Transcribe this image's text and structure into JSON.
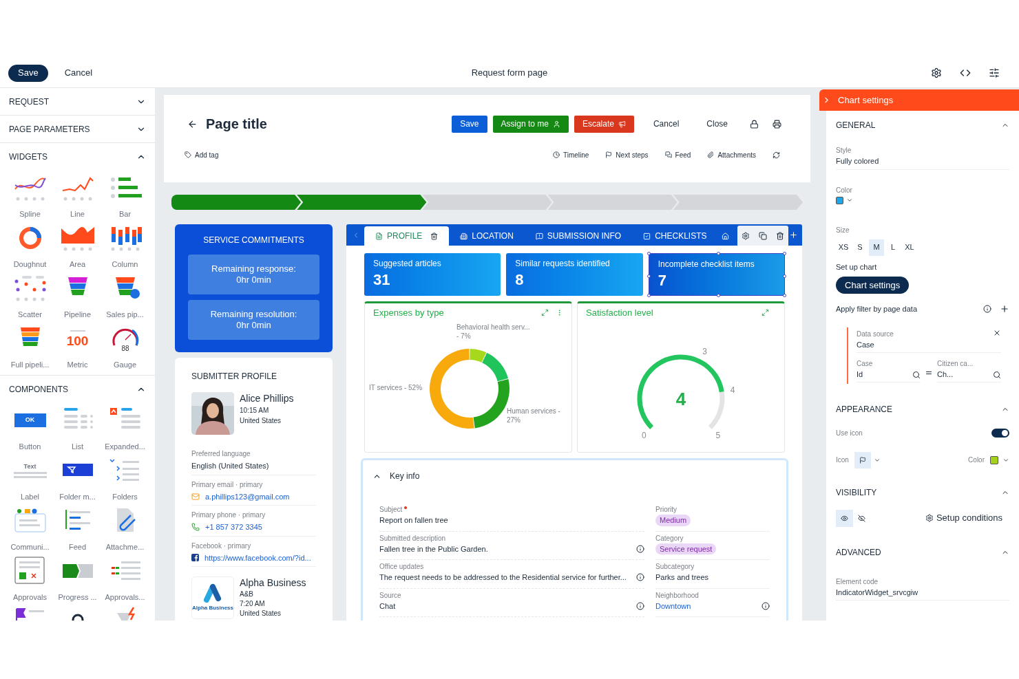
{
  "topbar": {
    "save": "Save",
    "cancel": "Cancel",
    "title": "Request form page"
  },
  "sidebar": {
    "sections": [
      {
        "title": "REQUEST",
        "expanded": false
      },
      {
        "title": "PAGE PARAMETERS",
        "expanded": false
      },
      {
        "title": "WIDGETS",
        "expanded": true,
        "items": [
          {
            "kind": "spline",
            "label": "Spline"
          },
          {
            "kind": "line",
            "label": "Line"
          },
          {
            "kind": "bar",
            "label": "Bar"
          },
          {
            "kind": "doughnut",
            "label": "Doughnut"
          },
          {
            "kind": "area",
            "label": "Area"
          },
          {
            "kind": "column",
            "label": "Column"
          },
          {
            "kind": "scatter",
            "label": "Scatter"
          },
          {
            "kind": "pipeline",
            "label": "Pipeline"
          },
          {
            "kind": "sales",
            "label": "Sales pip..."
          },
          {
            "kind": "fullpipe",
            "label": "Full pipeli..."
          },
          {
            "kind": "metric",
            "label": "Metric",
            "icon_text": "100"
          },
          {
            "kind": "gauge",
            "label": "Gauge",
            "icon_text": "88"
          }
        ]
      },
      {
        "title": "COMPONENTS",
        "expanded": true,
        "items": [
          {
            "kind": "button",
            "label": "Button",
            "icon_text": "OK"
          },
          {
            "kind": "list",
            "label": "List"
          },
          {
            "kind": "expanded",
            "label": "Expanded..."
          },
          {
            "kind": "label",
            "label": "Label",
            "icon_text": "Text"
          },
          {
            "kind": "folderm",
            "label": "Folder m..."
          },
          {
            "kind": "folders",
            "label": "Folders"
          },
          {
            "kind": "communi",
            "label": "Communi..."
          },
          {
            "kind": "feed",
            "label": "Feed"
          },
          {
            "kind": "attach",
            "label": "Attachme..."
          },
          {
            "kind": "approvals",
            "label": "Approvals"
          },
          {
            "kind": "progress",
            "label": "Progress ..."
          },
          {
            "kind": "approvals2",
            "label": "Approvals..."
          },
          {
            "kind": "flag"
          },
          {
            "kind": "circle"
          },
          {
            "kind": "bolt"
          }
        ]
      }
    ]
  },
  "page": {
    "title": "Page title",
    "buttons": [
      {
        "kind": "primary",
        "label": "Save"
      },
      {
        "kind": "assign",
        "label": "Assign to me"
      },
      {
        "kind": "escalate",
        "label": "Escalate"
      },
      {
        "kind": "plain",
        "label": "Cancel"
      },
      {
        "kind": "plain",
        "label": "Close"
      }
    ],
    "add_tag": "Add tag",
    "actions": [
      {
        "kind": "timeline",
        "label": "Timeline"
      },
      {
        "kind": "next",
        "label": "Next steps"
      },
      {
        "kind": "feed",
        "label": "Feed"
      },
      {
        "kind": "attachments",
        "label": "Attachments"
      }
    ]
  },
  "progress": [
    {
      "done": true
    },
    {
      "done": true
    },
    {
      "done": false
    },
    {
      "done": false
    },
    {
      "done": false
    }
  ],
  "service": {
    "title": "SERVICE COMMITMENTS",
    "items": [
      {
        "label": "Remaining response:",
        "value": "0hr 0min"
      },
      {
        "label": "Remaining resolution:",
        "value": "0hr 0min"
      }
    ]
  },
  "profile": {
    "title": "SUBMITTER PROFILE",
    "person": {
      "name": "Alice Phillips",
      "time": "10:15 AM",
      "country": "United States"
    },
    "fields": [
      {
        "label": "Preferred language",
        "value": "English (United States)",
        "kind": "text"
      },
      {
        "label": "Primary email · primary",
        "value": "a.phillips123@gmail.com",
        "kind": "email"
      },
      {
        "label": "Primary phone · primary",
        "value": "+1 857 372 3345",
        "kind": "phone"
      },
      {
        "label": "Facebook · primary",
        "value": "https://www.facebook.com/?id...",
        "kind": "facebook"
      }
    ],
    "company": {
      "logo_text": "Alpha Business",
      "name": "Alpha Business",
      "short": "A&B",
      "time": "7:20 AM",
      "country": "United States"
    }
  },
  "tabs": [
    {
      "kind": "profile",
      "label": "PROFILE",
      "selected": true
    },
    {
      "kind": "location",
      "label": "LOCATION",
      "selected": false
    },
    {
      "kind": "submission",
      "label": "SUBMISSION INFO",
      "selected": false
    },
    {
      "kind": "checklists",
      "label": "CHECKLISTS",
      "selected": false
    },
    {
      "kind": "neighborhood",
      "selected": false
    }
  ],
  "metrics": [
    {
      "label": "Suggested articles",
      "value": "31",
      "selected": false
    },
    {
      "label": "Similar requests identified",
      "value": "8",
      "selected": false
    },
    {
      "label": "Incomplete checklist items",
      "value": "7",
      "selected": true
    }
  ],
  "expenses": {
    "title": "Expenses by type",
    "chart_data": {
      "type": "donut",
      "categories": [
        "Behavioral health serv... - 7%",
        null,
        "Human services - 27%",
        "IT services - 52%"
      ],
      "values": [
        7,
        14,
        27,
        52
      ],
      "colors": [
        "#a8d81c",
        "#21c45a",
        "#24a31f",
        "#f8aa0c"
      ]
    }
  },
  "satisfaction": {
    "title": "Satisfaction level",
    "value": "4",
    "ticks": [
      "0",
      "3",
      "4",
      "5"
    ]
  },
  "key_info": {
    "title": "Key info",
    "expanded": true,
    "left": [
      {
        "label": "Subject",
        "value": "Report on fallen tree",
        "required": true,
        "info": false
      },
      {
        "label": "Submitted description",
        "value": "Fallen tree in the Public Garden.",
        "required": false,
        "info": true
      },
      {
        "label": "Office updates",
        "value": "The request needs to be addressed to the Residential service for further...",
        "required": false,
        "info": true
      },
      {
        "label": "Source",
        "value": "Chat",
        "required": false,
        "info": true
      }
    ],
    "right": [
      {
        "label": "Priority",
        "value": "Medium",
        "kind": "badge",
        "info": false
      },
      {
        "label": "Category",
        "value": "Service request",
        "kind": "badge",
        "info": false
      },
      {
        "label": "Subcategory",
        "value": "Parks and trees",
        "kind": "text",
        "info": false
      },
      {
        "label": "Neighborhood",
        "value": "Downtown",
        "kind": "link",
        "info": true
      }
    ]
  },
  "settings": {
    "title": "Chart settings",
    "general": {
      "title": "GENERAL",
      "expanded": true,
      "style_label": "Style",
      "style": "Fully colored",
      "color_label": "Color",
      "color": "#1ea5ea",
      "size_label": "Size",
      "sizes": [
        {
          "label": "XS",
          "selected": false
        },
        {
          "label": "S",
          "selected": false
        },
        {
          "label": "M",
          "selected": true
        },
        {
          "label": "L",
          "selected": false
        },
        {
          "label": "XL",
          "selected": false
        }
      ],
      "setup_label": "Set up chart",
      "setup_button": "Chart settings",
      "filter_label": "Apply filter by page data",
      "filter": {
        "source_label": "Data source",
        "source": "Case",
        "left_label": "Case",
        "left": "Id",
        "right_label": "Citizen ca...",
        "right": "Ch..."
      }
    },
    "appearance": {
      "title": "APPEARANCE",
      "expanded": true,
      "use_icon_label": "Use icon",
      "use_icon": true,
      "icon_label": "Icon",
      "color_label": "Color",
      "color": "#a3d11c"
    },
    "visibility": {
      "title": "VISIBILITY",
      "expanded": true,
      "options": [
        {
          "kind": "visible",
          "selected": true
        },
        {
          "kind": "hidden",
          "selected": false
        }
      ],
      "conditions": "Setup conditions"
    },
    "advanced": {
      "title": "ADVANCED",
      "expanded": true,
      "code_label": "Element code",
      "code": "IndicatorWidget_srvcgiw"
    }
  }
}
